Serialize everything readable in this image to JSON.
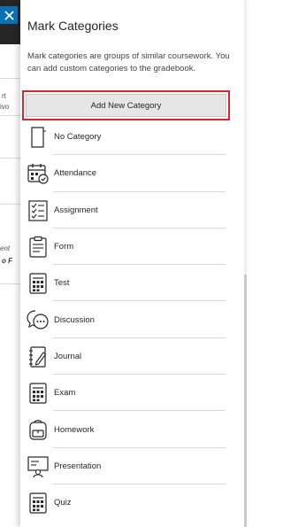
{
  "background": {
    "snippets": [
      "rt",
      "ivo",
      "ent",
      "o F"
    ]
  },
  "panel": {
    "title": "Mark Categories",
    "description": "Mark categories are groups of similar coursework. You can add custom categories to the gradebook.",
    "add_button": "Add New Category",
    "close_icon": "close-icon",
    "accent_color": "#0b6fb3",
    "highlight_color": "#d9262a"
  },
  "categories": [
    {
      "label": "No Category",
      "icon": "blank-page-icon"
    },
    {
      "label": "Attendance",
      "icon": "calendar-check-icon"
    },
    {
      "label": "Assignment",
      "icon": "checklist-icon"
    },
    {
      "label": "Form",
      "icon": "clipboard-icon"
    },
    {
      "label": "Test",
      "icon": "calculator-icon"
    },
    {
      "label": "Discussion",
      "icon": "chat-bubbles-icon"
    },
    {
      "label": "Journal",
      "icon": "journal-pen-icon"
    },
    {
      "label": "Exam",
      "icon": "calculator-icon"
    },
    {
      "label": "Homework",
      "icon": "backpack-icon"
    },
    {
      "label": "Presentation",
      "icon": "presentation-board-icon"
    },
    {
      "label": "Quiz",
      "icon": "calculator-icon"
    }
  ]
}
